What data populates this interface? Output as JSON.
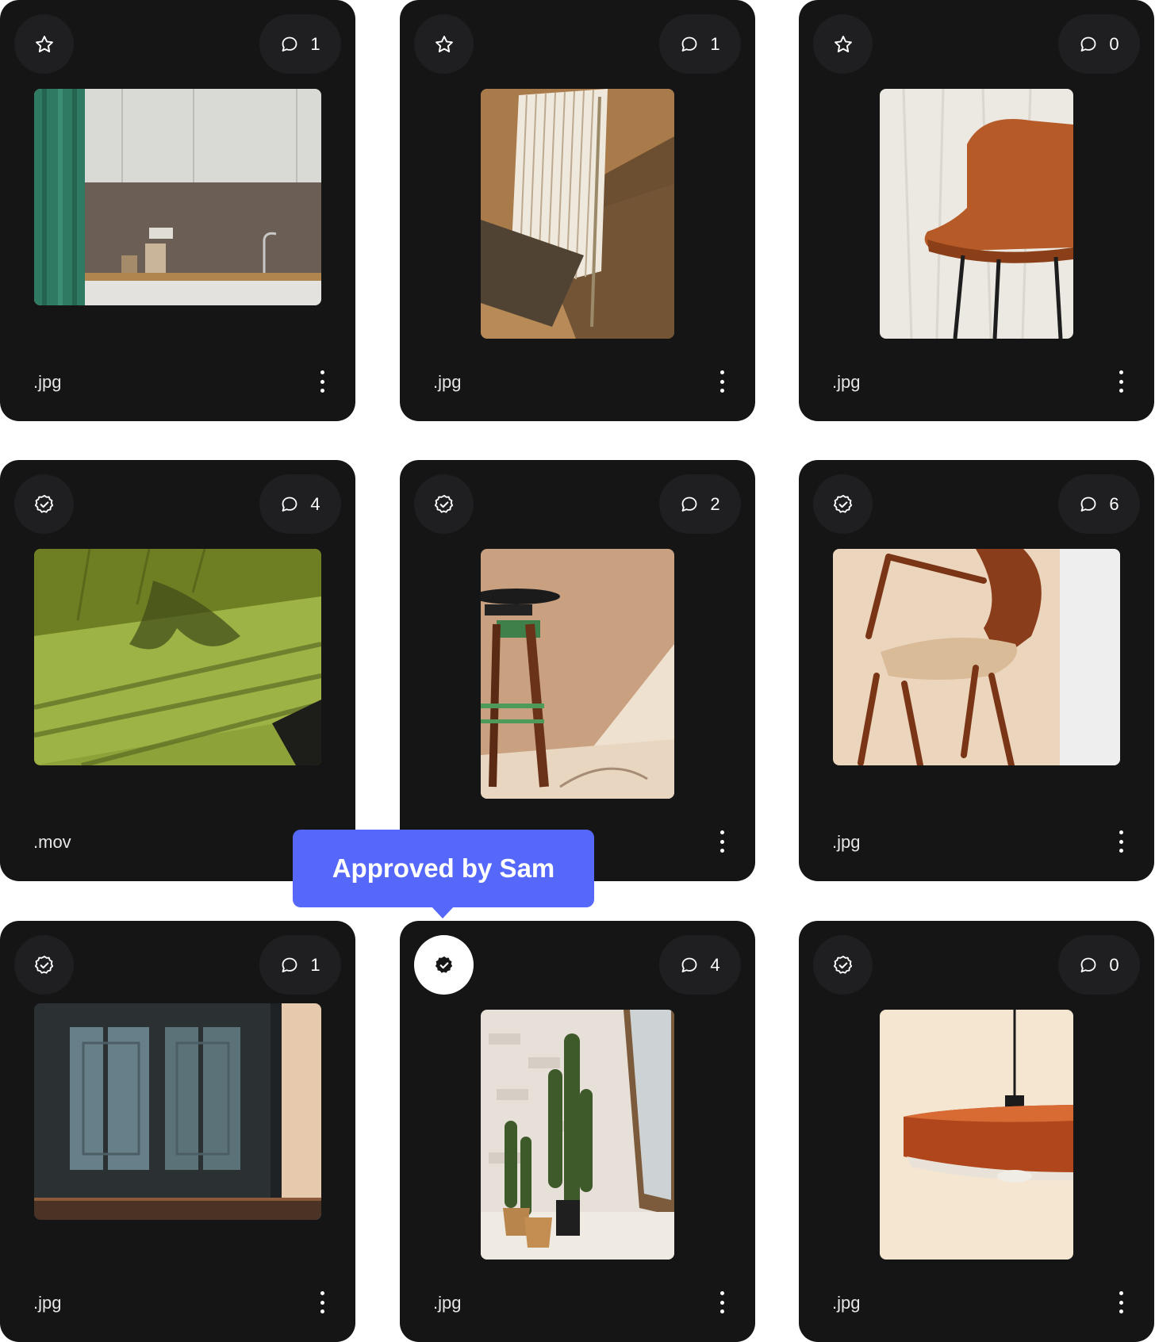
{
  "tooltip": {
    "text": "Approved by Sam"
  },
  "cards": [
    {
      "status_icon": "star-icon",
      "comments": "1",
      "ext": ".jpg",
      "image": "kitchen-photo"
    },
    {
      "status_icon": "star-icon",
      "comments": "1",
      "ext": ".jpg",
      "image": "rope-chair-photo"
    },
    {
      "status_icon": "star-icon",
      "comments": "0",
      "ext": ".jpg",
      "image": "leather-stool-photo"
    },
    {
      "status_icon": "approved-badge-icon",
      "comments": "4",
      "ext": ".mov",
      "image": "green-sofa-photo"
    },
    {
      "status_icon": "approved-badge-icon",
      "comments": "2",
      "ext": "",
      "image": "bar-stool-photo"
    },
    {
      "status_icon": "approved-badge-icon",
      "comments": "6",
      "ext": ".jpg",
      "image": "wooden-armchair-photo"
    },
    {
      "status_icon": "approved-badge-icon",
      "comments": "1",
      "ext": ".jpg",
      "image": "dark-door-photo"
    },
    {
      "status_icon": "approved-badge-filled-icon",
      "comments": "4",
      "ext": ".jpg",
      "image": "cactus-photo"
    },
    {
      "status_icon": "approved-badge-icon",
      "comments": "0",
      "ext": ".jpg",
      "image": "pendant-lamp-photo"
    }
  ]
}
